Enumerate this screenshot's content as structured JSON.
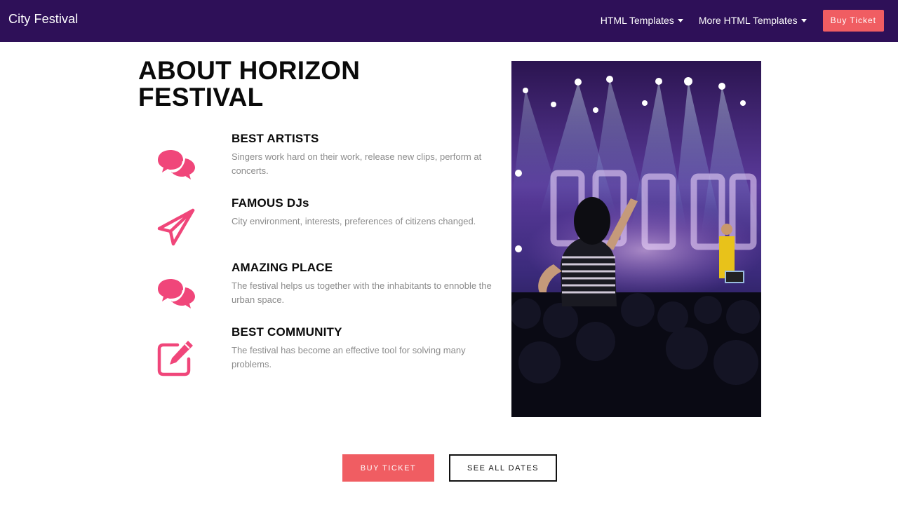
{
  "navbar": {
    "brand": "City Festival",
    "links": [
      {
        "label": "HTML Templates"
      },
      {
        "label": "More HTML Templates"
      }
    ],
    "buy_label": "Buy Ticket",
    "background": "#2e1058"
  },
  "about": {
    "title": "ABOUT HORIZON FESTIVAL",
    "features": [
      {
        "icon": "chat-bubbles-icon",
        "title": "BEST ARTISTS",
        "description": "Singers work hard on their work, release new clips, perform at concerts."
      },
      {
        "icon": "paper-plane-icon",
        "title": "FAMOUS DJs",
        "description": "City environment, interests, preferences of citizens changed."
      },
      {
        "icon": "chat-bubbles-icon",
        "title": "AMAZING PLACE",
        "description": "The festival helps us together with the inhabitants to ennoble the urban space."
      },
      {
        "icon": "edit-square-icon",
        "title": "BEST COMMUNITY",
        "description": "The festival has become an effective tool for solving many problems."
      }
    ],
    "icon_color": "#f0467a",
    "image": "concert-crowd-photo"
  },
  "actions": {
    "buy_label": "BUY TICKET",
    "dates_label": "SEE ALL DATES",
    "accent": "#f05d62"
  }
}
